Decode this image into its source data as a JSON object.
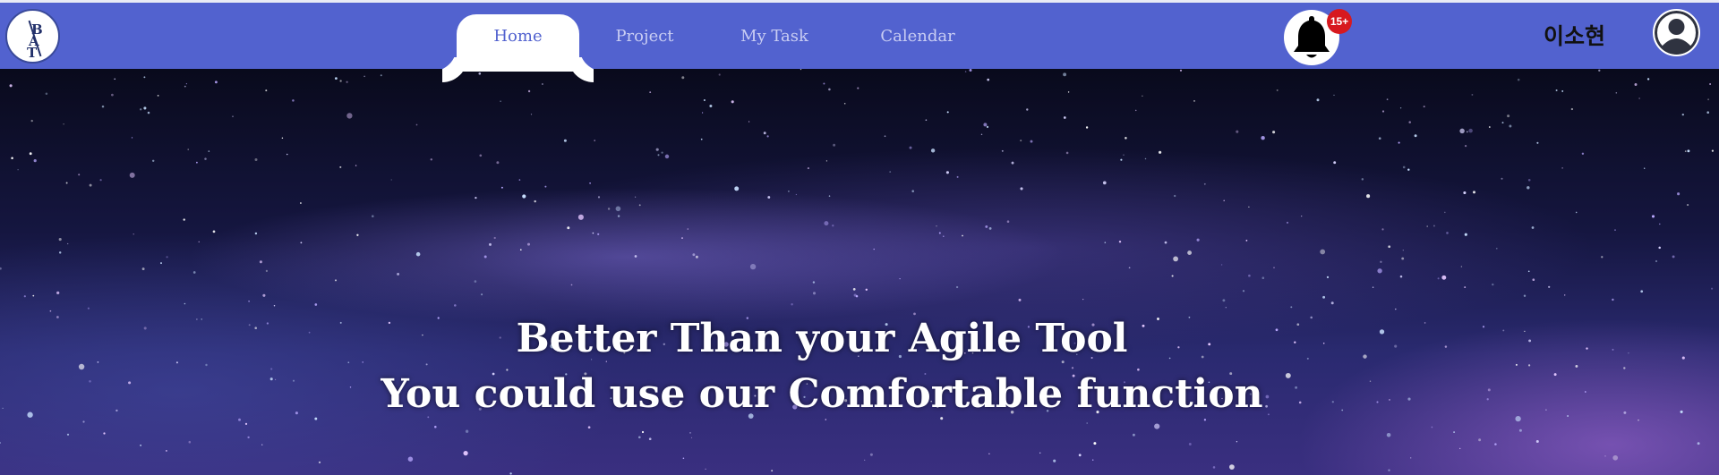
{
  "logo": {
    "letters": [
      "B",
      "A",
      "T"
    ]
  },
  "nav": {
    "tabs": [
      {
        "label": "Home",
        "active": true
      },
      {
        "label": "Project",
        "active": false
      },
      {
        "label": "My Task",
        "active": false
      },
      {
        "label": "Calendar",
        "active": false
      }
    ]
  },
  "notifications": {
    "badge": "15+",
    "icon": "bell-icon"
  },
  "user": {
    "name": "이소현",
    "icon": "user-avatar-icon"
  },
  "hero": {
    "line1": "Better Than your Agile Tool",
    "line2": "You could use our Comfortable function"
  },
  "colors": {
    "navbar": "#5262cf",
    "active_tab_bg": "#ffffff",
    "active_tab_text": "#5262cf",
    "inactive_tab_text": "#c9cdf3",
    "badge": "#d7191f"
  }
}
